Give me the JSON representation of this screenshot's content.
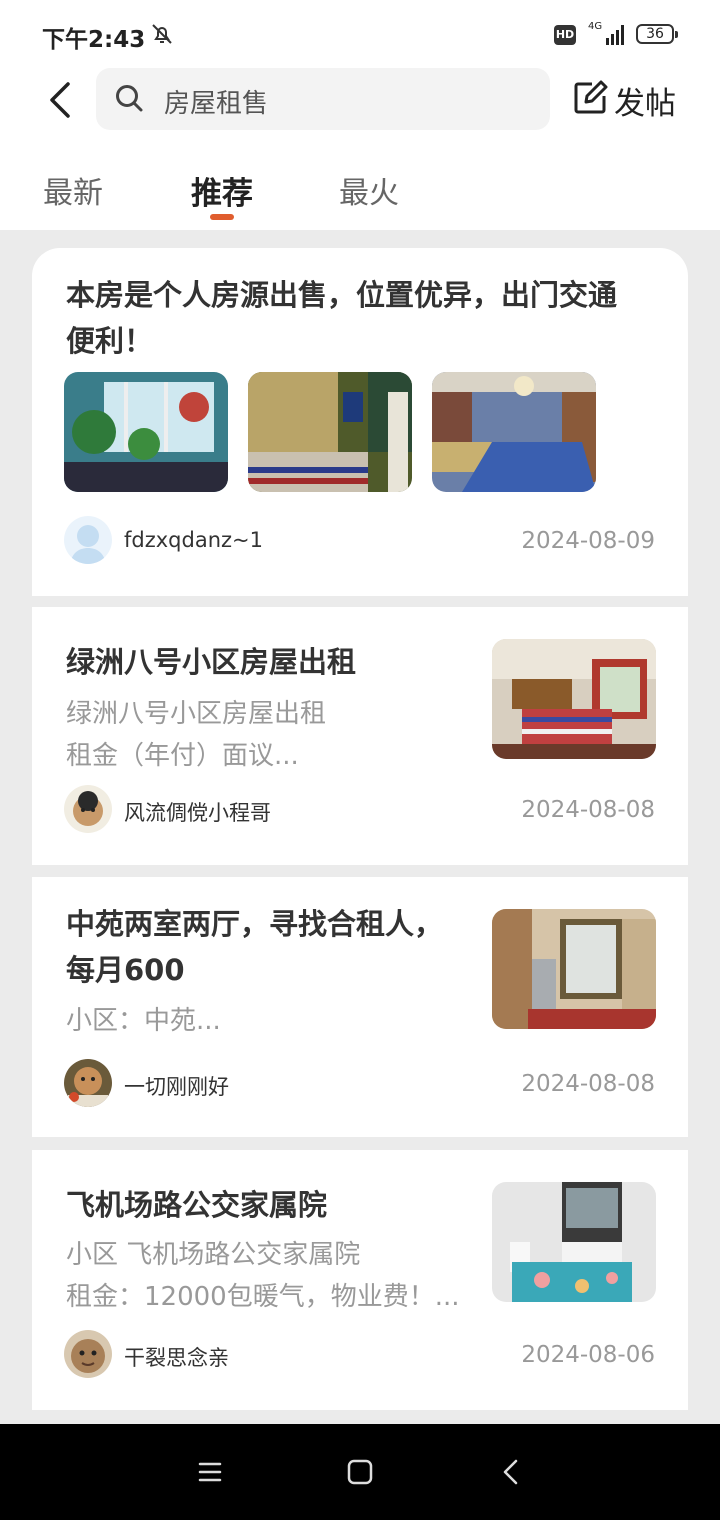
{
  "status_bar": {
    "time": "下午2:43",
    "hd_label": "HD",
    "network": "4G",
    "battery": "36"
  },
  "header": {
    "search_placeholder": "房屋租售",
    "post_label": "发帖"
  },
  "tabs": [
    {
      "label": "最新",
      "active": false
    },
    {
      "label": "推荐",
      "active": true
    },
    {
      "label": "最火",
      "active": false
    }
  ],
  "accent_color": "#e05d2e",
  "posts": [
    {
      "title_lines": [
        "本房是个人房源出售，位置优异，出门交通",
        "便利！"
      ],
      "author": "fdzxqdanz~1",
      "date": "2024-08-09"
    },
    {
      "title": "绿洲八号小区房屋出租",
      "desc_lines": [
        "绿洲八号小区房屋出租",
        "租金（年付）面议..."
      ],
      "author": "风流倜傥小程哥",
      "date": "2024-08-08"
    },
    {
      "title_lines": [
        "中苑两室两厅，寻找合租人，",
        "每月600"
      ],
      "desc_lines": [
        "小区：中苑..."
      ],
      "author": "一切刚刚好",
      "date": "2024-08-08"
    },
    {
      "title": "飞机场路公交家属院",
      "desc_lines": [
        "小区 飞机场路公交家属院",
        "租金：12000包暖气，物业费！..."
      ],
      "author": "干裂思念亲",
      "date": "2024-08-06"
    }
  ]
}
